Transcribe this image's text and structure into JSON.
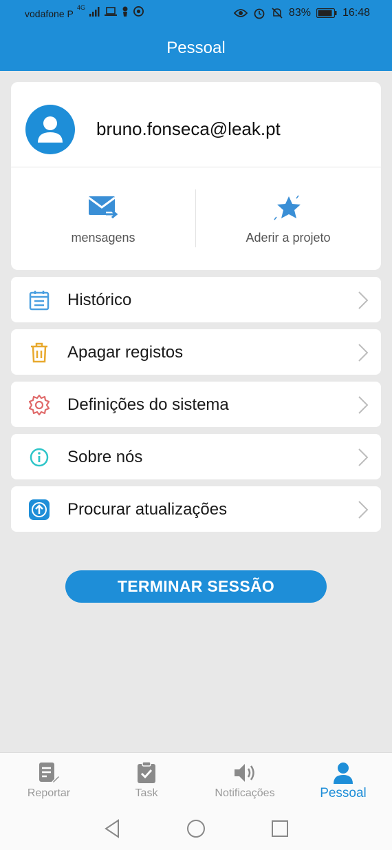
{
  "status_bar": {
    "carrier": "vodafone P",
    "network": "4G",
    "battery": "83%",
    "time": "16:48"
  },
  "header": {
    "title": "Pessoal"
  },
  "profile": {
    "email": "bruno.fonseca@leak.pt",
    "actions": [
      {
        "label": "mensagens",
        "icon": "mail-forward-icon"
      },
      {
        "label": "Aderir a projeto",
        "icon": "star-icon"
      }
    ]
  },
  "menu": [
    {
      "label": "Histórico",
      "icon": "calendar-icon",
      "color": "#4a9fe0"
    },
    {
      "label": "Apagar registos",
      "icon": "trash-icon",
      "color": "#e8a92e"
    },
    {
      "label": "Definições do sistema",
      "icon": "gear-icon",
      "color": "#e06a6a"
    },
    {
      "label": "Sobre nós",
      "icon": "info-icon",
      "color": "#2ec5c8"
    },
    {
      "label": "Procurar atualizações",
      "icon": "update-icon",
      "color": "#1e8ed8"
    }
  ],
  "logout_label": "TERMINAR SESSÃO",
  "bottom_nav": [
    {
      "label": "Reportar",
      "icon": "report-icon",
      "active": false
    },
    {
      "label": "Task",
      "icon": "task-icon",
      "active": false
    },
    {
      "label": "Notificações",
      "icon": "speaker-icon",
      "active": false
    },
    {
      "label": "Pessoal",
      "icon": "person-icon",
      "active": true
    }
  ],
  "colors": {
    "accent": "#1e8ed8",
    "background": "#e8e8e8",
    "inactive": "#9a9a9a"
  }
}
